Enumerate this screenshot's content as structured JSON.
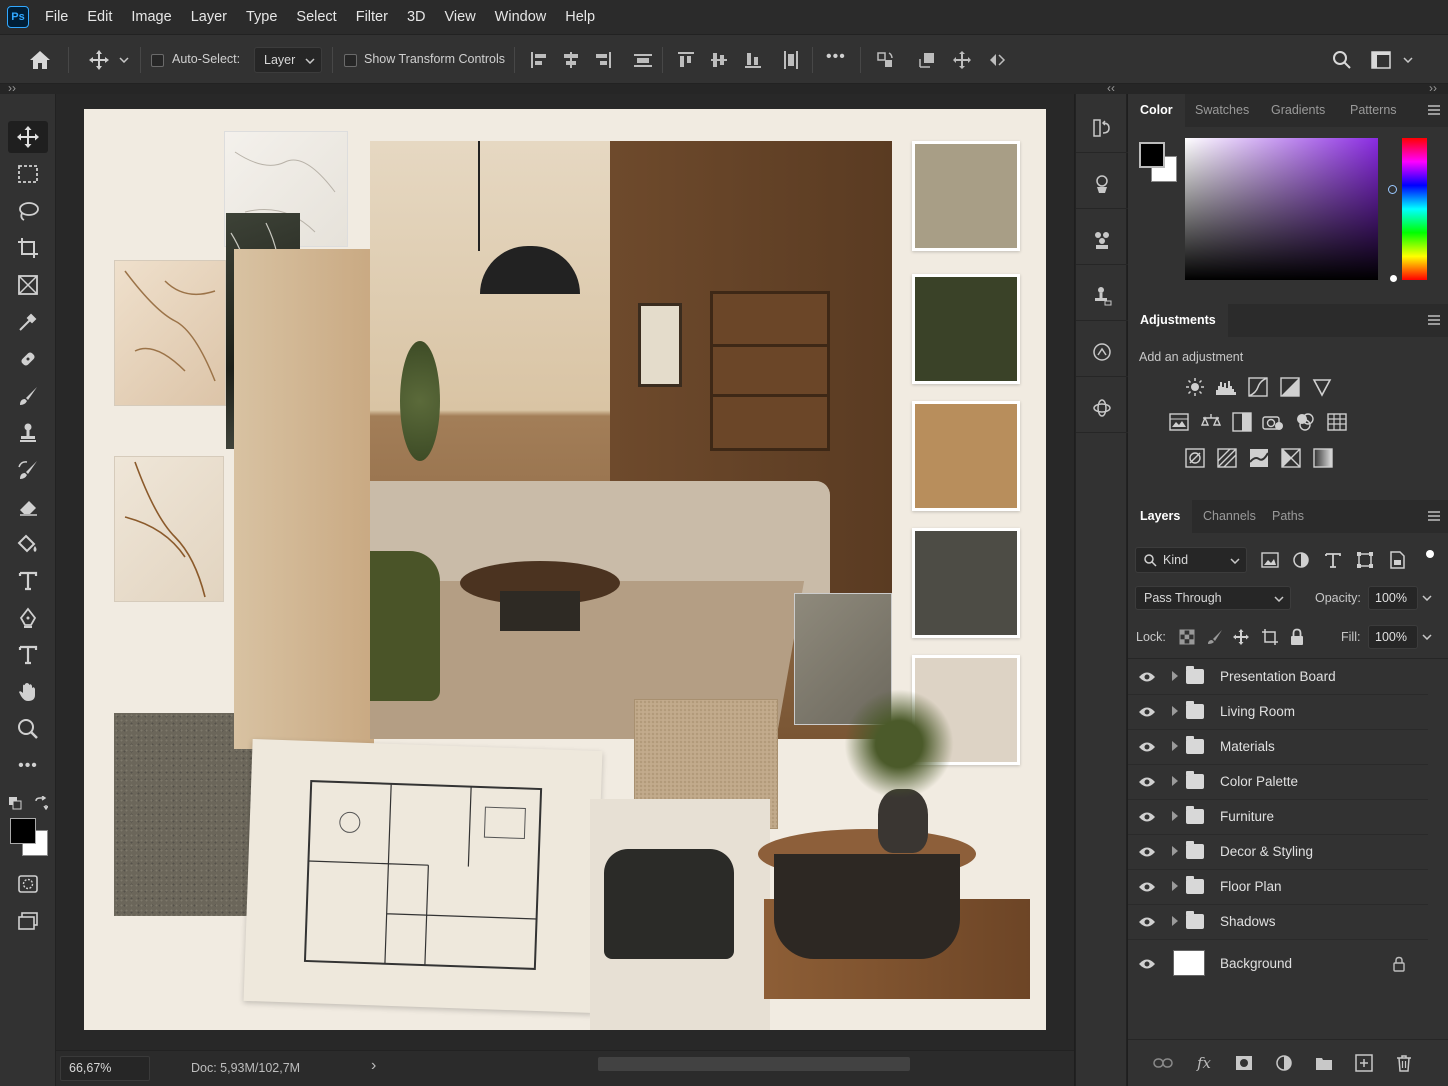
{
  "app": {
    "logo": "Ps"
  },
  "menu": [
    "File",
    "Edit",
    "Image",
    "Layer",
    "Type",
    "Select",
    "Filter",
    "3D",
    "View",
    "Window",
    "Help"
  ],
  "options": {
    "auto_select_label": "Auto-Select:",
    "auto_select_target": "Layer",
    "show_transform_label": "Show Transform Controls",
    "more_label": "•••"
  },
  "toolbar": {
    "more_label": "•••"
  },
  "status": {
    "zoom": "66,67%",
    "doc": "Doc: 5,93M/102,7M"
  },
  "color_panel": {
    "tabs": [
      "Color",
      "Swatches",
      "Gradients",
      "Patterns"
    ],
    "foreground": "#000000",
    "background": "#ffffff",
    "hue_color": "#8a2be2"
  },
  "adjustments_panel": {
    "title": "Adjustments",
    "subtitle": "Add an adjustment"
  },
  "layers_panel": {
    "tabs": [
      "Layers",
      "Channels",
      "Paths"
    ],
    "filter_label": "Kind",
    "blend_mode": "Pass Through",
    "opacity_label": "Opacity:",
    "opacity_value": "100%",
    "lock_label": "Lock:",
    "fill_label": "Fill:",
    "fill_value": "100%",
    "layers": [
      {
        "name": "Presentation Board",
        "type": "group"
      },
      {
        "name": "Living Room",
        "type": "group"
      },
      {
        "name": "Materials",
        "type": "group"
      },
      {
        "name": "Color Palette",
        "type": "group"
      },
      {
        "name": "Furniture",
        "type": "group"
      },
      {
        "name": "Decor & Styling",
        "type": "group"
      },
      {
        "name": "Floor Plan",
        "type": "group"
      },
      {
        "name": "Shadows",
        "type": "group"
      },
      {
        "name": "Background",
        "type": "locked"
      }
    ]
  },
  "canvas": {
    "palette_swatches": [
      "#a89e86",
      "#3a4228",
      "#b88e5c",
      "#4d4c45",
      "#ddd3c5"
    ]
  }
}
